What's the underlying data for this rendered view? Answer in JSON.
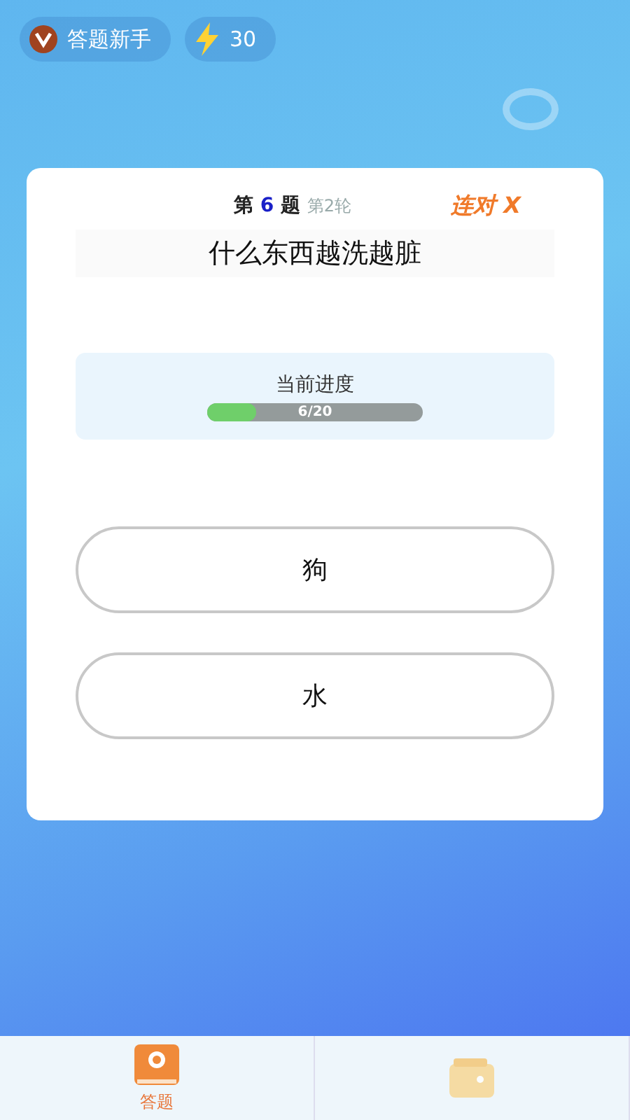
{
  "header": {
    "rank": "答题新手",
    "energy": "30"
  },
  "quiz": {
    "counter": {
      "prefix": "第",
      "number": "6",
      "suffix": "题",
      "round": "第2轮"
    },
    "streak": "连对 X",
    "question": "什么东西越洗越脏",
    "progress": {
      "label": "当前进度",
      "level": 0.23,
      "reading": "6/20"
    },
    "options": [
      "狗",
      "水"
    ]
  },
  "tabs": [
    {
      "label": "答题",
      "kind": "book",
      "selected": true
    },
    {
      "kind": "wallet",
      "selected": false
    }
  ]
}
